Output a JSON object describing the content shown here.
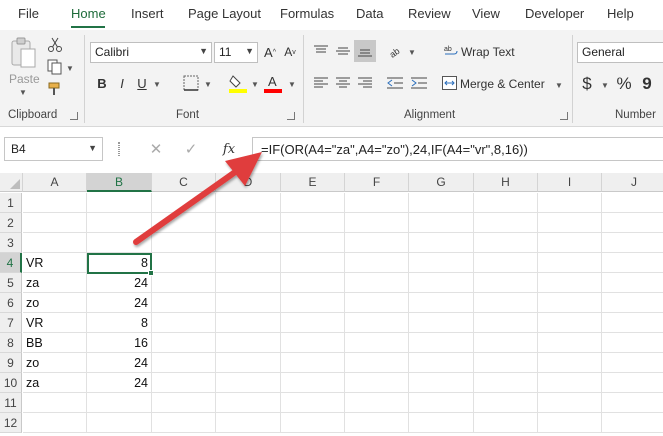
{
  "menu": {
    "tabs": [
      "File",
      "Home",
      "Insert",
      "Page Layout",
      "Formulas",
      "Data",
      "Review",
      "View",
      "Developer",
      "Help"
    ],
    "active": "Home"
  },
  "ribbon": {
    "clipboard": {
      "label": "Clipboard",
      "paste": "Paste"
    },
    "font": {
      "label": "Font",
      "font_name": "Calibri",
      "font_size": "11",
      "bold": "B",
      "italic": "I",
      "underline": "U"
    },
    "alignment": {
      "label": "Alignment",
      "wrap_text": "Wrap Text",
      "merge_center": "Merge & Center"
    },
    "number": {
      "label": "Number",
      "format": "General",
      "currency": "$",
      "percent": "%",
      "comma": "9"
    },
    "colors": {
      "accent": "#217346",
      "highlight": "#ffff00",
      "font_color": "#ff0000"
    }
  },
  "formula_bar": {
    "name_box": "B4",
    "fx": "fx",
    "formula": "=IF(OR(A4=\"za\",A4=\"zo\"),24,IF(A4=\"vr\",8,16))"
  },
  "grid": {
    "columns": [
      "A",
      "B",
      "C",
      "D",
      "E",
      "F",
      "G",
      "H",
      "I",
      "J"
    ],
    "rows": [
      "1",
      "2",
      "3",
      "4",
      "5",
      "6",
      "7",
      "8",
      "9",
      "10",
      "11",
      "12"
    ],
    "selected_cell": "B4",
    "data": [
      [
        "",
        ""
      ],
      [
        "",
        ""
      ],
      [
        "",
        ""
      ],
      [
        "VR",
        "8"
      ],
      [
        "za",
        "24"
      ],
      [
        "zo",
        "24"
      ],
      [
        "VR",
        "8"
      ],
      [
        "BB",
        "16"
      ],
      [
        "zo",
        "24"
      ],
      [
        "za",
        "24"
      ],
      [
        "",
        ""
      ],
      [
        "",
        ""
      ]
    ]
  },
  "annotation": {
    "arrow_color": "#e03c3c"
  }
}
